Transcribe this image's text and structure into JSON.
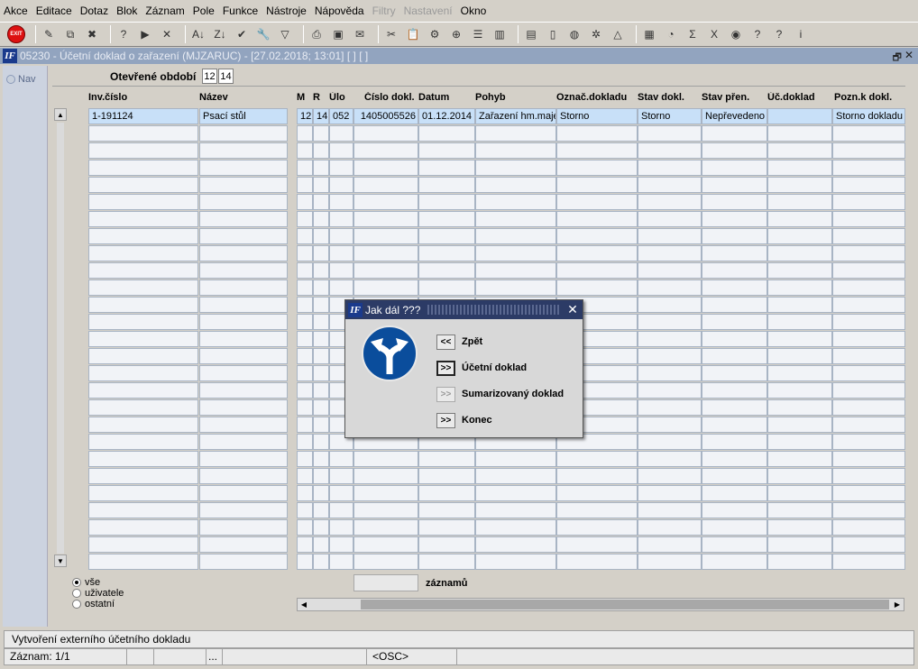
{
  "menubar": {
    "items": [
      {
        "label": "Akce",
        "enabled": true
      },
      {
        "label": "Editace",
        "enabled": true
      },
      {
        "label": "Dotaz",
        "enabled": true
      },
      {
        "label": "Blok",
        "enabled": true
      },
      {
        "label": "Záznam",
        "enabled": true
      },
      {
        "label": "Pole",
        "enabled": true
      },
      {
        "label": "Funkce",
        "enabled": true
      },
      {
        "label": "Nástroje",
        "enabled": true
      },
      {
        "label": "Nápověda",
        "enabled": true
      },
      {
        "label": "Filtry",
        "enabled": false
      },
      {
        "label": "Nastavení",
        "enabled": false
      },
      {
        "label": "Okno",
        "enabled": true
      }
    ]
  },
  "toolbar": {
    "exit_label": "EXIT",
    "icons": [
      "exit-icon",
      "sep",
      "edit-icon",
      "copy-record-icon",
      "delete-record-icon",
      "sep",
      "new-query-icon",
      "execute-query-icon",
      "clear-icon",
      "sep",
      "sort-asc-icon",
      "sort-desc-icon",
      "check-icon",
      "wrench-icon",
      "filter-icon",
      "sep",
      "print-icon",
      "save-icon",
      "mail-icon",
      "sep",
      "cut-icon",
      "paste-icon",
      "tools-icon",
      "zoom-icon",
      "list-icon",
      "columns-icon",
      "sep",
      "report-icon",
      "document-icon",
      "globe-icon",
      "settings-icon",
      "chart-icon",
      "sep",
      "form-icon",
      "gauge-icon",
      "sum-icon",
      "excel-icon",
      "refresh-icon",
      "help-icon",
      "context-help-icon",
      "info-icon"
    ],
    "glyphs": {
      "edit-icon": "✎",
      "copy-record-icon": "⧉",
      "delete-record-icon": "✖",
      "new-query-icon": "?",
      "execute-query-icon": "▶",
      "clear-icon": "✕",
      "sort-asc-icon": "A↓",
      "sort-desc-icon": "Z↓",
      "check-icon": "✔",
      "wrench-icon": "🔧",
      "filter-icon": "▽",
      "print-icon": "⎙",
      "save-icon": "▣",
      "mail-icon": "✉",
      "cut-icon": "✂",
      "paste-icon": "📋",
      "tools-icon": "⚙",
      "zoom-icon": "⊕",
      "list-icon": "☰",
      "columns-icon": "▥",
      "report-icon": "▤",
      "document-icon": "▯",
      "globe-icon": "◍",
      "settings-icon": "✲",
      "chart-icon": "△",
      "form-icon": "▦",
      "gauge-icon": "◔",
      "sum-icon": "Σ",
      "excel-icon": "X",
      "refresh-icon": "◉",
      "help-icon": "?",
      "context-help-icon": "?",
      "info-icon": "i"
    }
  },
  "window": {
    "title": "05230 - Účetní doklad o zařazení (MJZARUC) - [27.02.2018; 13:01]  [ ]  [ ]",
    "logo": "IF",
    "restore": "🗗",
    "close": "✕"
  },
  "nav": {
    "label": "Nav"
  },
  "period": {
    "label": "Otevřené období",
    "month": "12",
    "year": "14"
  },
  "columns": [
    "Inv.číslo",
    "Název",
    "M",
    "R",
    "Úlo",
    "Číslo dokl.",
    "Datum",
    "Pohyb",
    "Označ.dokladu",
    "Stav dokl.",
    "Stav přen.",
    "Úč.doklad",
    "Pozn.k dokl."
  ],
  "rows": [
    [
      "1-191124",
      "Psací stůl",
      "12",
      "14",
      "052",
      "1405005526",
      "01.12.2014",
      "Zařazení hm.maje",
      "Storno",
      "Storno",
      "Nepřevedeno",
      "",
      "Storno dokladu"
    ]
  ],
  "scroll": {
    "up": "▲",
    "down": "▼",
    "left": "◀",
    "right": "▶"
  },
  "filter": {
    "options": [
      "vše",
      "uživatele",
      "ostatní"
    ],
    "selected": "vše"
  },
  "count": {
    "label": "záznamů",
    "value": ""
  },
  "hint": "Vytvoření externího účetního dokladu",
  "status": {
    "record": "Záznam: 1/1",
    "dots": "...",
    "mode": "<OSC>"
  },
  "dialog": {
    "title": "Jak dál ???",
    "close": "✕",
    "buttons": [
      {
        "symbol": "<<",
        "label": "Zpět",
        "enabled": true,
        "focused": false
      },
      {
        "symbol": ">>",
        "label": "Účetní doklad",
        "enabled": true,
        "focused": true
      },
      {
        "symbol": ">>",
        "label": "Sumarizovaný doklad",
        "enabled": false,
        "focused": false
      },
      {
        "symbol": ">>",
        "label": "Konec",
        "enabled": true,
        "focused": false
      }
    ]
  }
}
